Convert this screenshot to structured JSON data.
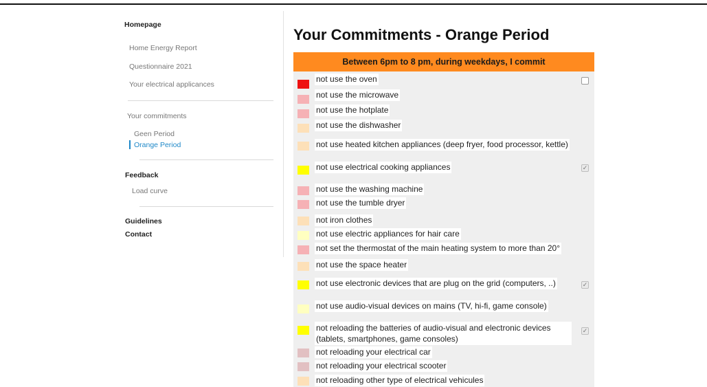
{
  "sidebar": {
    "homepage": "Homepage",
    "home_energy_report": "Home Energy Report",
    "questionnaire": "Questionnaire 2021",
    "electrical_appliances": "Your electrical applicances",
    "your_commitments": "Your commitments",
    "geen_period": "Geen Period",
    "orange_period": "Orange Period",
    "feedback": "Feedback",
    "load_curve": "Load curve",
    "guidelines": "Guidelines",
    "contact": "Contact"
  },
  "main": {
    "title": "Your Commitments - Orange Period",
    "banner": "Between 6pm to 8 pm, during weekdays, I commit",
    "checkmark": "✓"
  },
  "colors": {
    "accent": "#ff8a1f",
    "link": "#1e88c8",
    "red": "#ee1111",
    "pink": "#f6b1b5",
    "peach": "#fde0b8",
    "yellow": "#ffff00",
    "pale_yellow": "#ffffc0",
    "mauve": "#e2c0c2"
  },
  "commitments": [
    {
      "label": "not use the oven",
      "color": "red",
      "checkbox": "unchecked"
    },
    {
      "label": "not use the microwave",
      "color": "pink",
      "checkbox": "none"
    },
    {
      "label": "not use the hotplate",
      "color": "pink",
      "checkbox": "none"
    },
    {
      "label": "not use the dishwasher",
      "color": "peach",
      "checkbox": "none"
    },
    {
      "label": "not use heated kitchen appliances (deep fryer, food processor, kettle)",
      "color": "peach",
      "checkbox": "none"
    },
    {
      "label": "not use electrical cooking appliances",
      "color": "yellow",
      "checkbox": "checked"
    },
    {
      "label": "not use the washing machine",
      "color": "pink",
      "checkbox": "none"
    },
    {
      "label": "not use the tumble dryer",
      "color": "pink",
      "checkbox": "none"
    },
    {
      "label": "not iron clothes",
      "color": "peach",
      "checkbox": "none"
    },
    {
      "label": "not use electric appliances for hair care",
      "color": "pale_yellow",
      "checkbox": "none"
    },
    {
      "label": "not set the thermostat of the main heating system to more than 20°",
      "color": "pink",
      "checkbox": "none"
    },
    {
      "label": "not use the space heater",
      "color": "peach",
      "checkbox": "none"
    },
    {
      "label": "not use electronic devices that are plug on the grid (computers, ..)",
      "color": "yellow",
      "checkbox": "checked"
    },
    {
      "label": "not use audio-visual devices on mains (TV, hi-fi, game console)",
      "color": "pale_yellow",
      "checkbox": "none"
    },
    {
      "label": "not reloading the batteries of audio-visual and electronic devices (tablets, smartphones, game consoles)",
      "color": "yellow",
      "checkbox": "checked"
    },
    {
      "label": "not reloading your electrical car",
      "color": "mauve",
      "checkbox": "none"
    },
    {
      "label": "not reloading your electrical scooter",
      "color": "mauve",
      "checkbox": "none"
    },
    {
      "label": "not reloading other type of electrical vehicules",
      "color": "peach",
      "checkbox": "none"
    }
  ]
}
